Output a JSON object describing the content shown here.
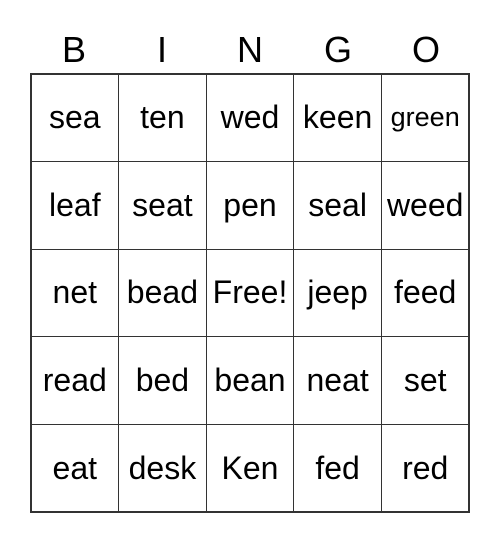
{
  "header": [
    "B",
    "I",
    "N",
    "G",
    "O"
  ],
  "cells": [
    [
      "sea",
      "ten",
      "wed",
      "keen",
      "green"
    ],
    [
      "leaf",
      "seat",
      "pen",
      "seal",
      "weed"
    ],
    [
      "net",
      "bead",
      "Free!",
      "jeep",
      "feed"
    ],
    [
      "read",
      "bed",
      "bean",
      "neat",
      "set"
    ],
    [
      "eat",
      "desk",
      "Ken",
      "fed",
      "red"
    ]
  ]
}
